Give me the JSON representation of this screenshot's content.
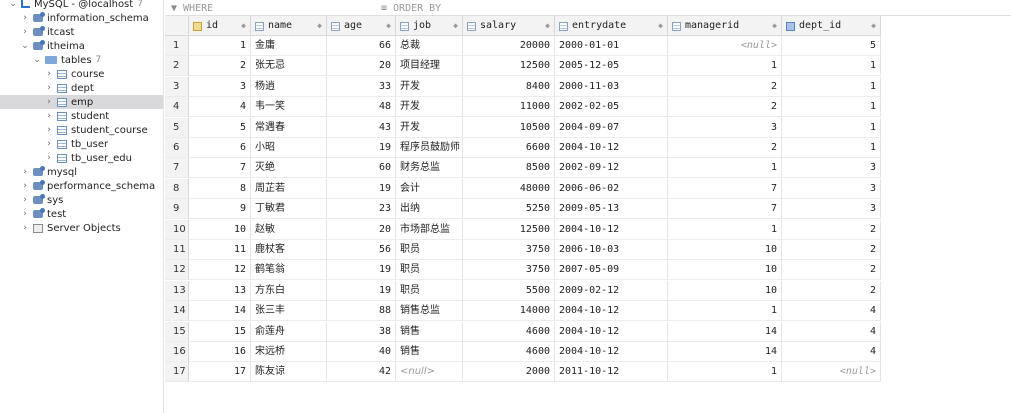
{
  "sidebar": {
    "items": [
      {
        "label": "MySQL - @localhost",
        "badge": "7",
        "icon": "host-icon",
        "chevron": "⌄",
        "depth": 0,
        "name": "tree-item-localhost"
      },
      {
        "label": "information_schema",
        "icon": "database-icon",
        "chevron": "›",
        "depth": 1,
        "name": "tree-item-information-schema"
      },
      {
        "label": "itcast",
        "icon": "database-icon",
        "chevron": "›",
        "depth": 1,
        "name": "tree-item-itcast"
      },
      {
        "label": "itheima",
        "icon": "database-icon",
        "chevron": "⌄",
        "depth": 1,
        "name": "tree-item-itheima"
      },
      {
        "label": "tables",
        "badge": "7",
        "icon": "folder-icon",
        "chevron": "⌄",
        "depth": 2,
        "name": "tree-item-tables"
      },
      {
        "label": "course",
        "icon": "table-icon",
        "chevron": "›",
        "depth": 3,
        "name": "tree-item-course"
      },
      {
        "label": "dept",
        "icon": "table-icon",
        "chevron": "›",
        "depth": 3,
        "name": "tree-item-dept"
      },
      {
        "label": "emp",
        "icon": "table-icon",
        "chevron": "›",
        "depth": 3,
        "name": "tree-item-emp",
        "selected": true
      },
      {
        "label": "student",
        "icon": "table-icon",
        "chevron": "›",
        "depth": 3,
        "name": "tree-item-student"
      },
      {
        "label": "student_course",
        "icon": "table-icon",
        "chevron": "›",
        "depth": 3,
        "name": "tree-item-student-course"
      },
      {
        "label": "tb_user",
        "icon": "table-icon",
        "chevron": "›",
        "depth": 3,
        "name": "tree-item-tb-user"
      },
      {
        "label": "tb_user_edu",
        "icon": "table-icon",
        "chevron": "›",
        "depth": 3,
        "name": "tree-item-tb-user-edu"
      },
      {
        "label": "mysql",
        "icon": "database-icon",
        "chevron": "›",
        "depth": 1,
        "name": "tree-item-mysql"
      },
      {
        "label": "performance_schema",
        "icon": "database-icon",
        "chevron": "›",
        "depth": 1,
        "name": "tree-item-performance-schema"
      },
      {
        "label": "sys",
        "icon": "database-icon",
        "chevron": "›",
        "depth": 1,
        "name": "tree-item-sys"
      },
      {
        "label": "test",
        "icon": "database-icon",
        "chevron": "›",
        "depth": 1,
        "name": "tree-item-test"
      },
      {
        "label": "Server Objects",
        "icon": "server-objects-icon",
        "chevron": "›",
        "depth": 1,
        "name": "tree-item-server-objects"
      }
    ]
  },
  "filter": {
    "where_icon": "filter-icon",
    "where_label": "WHERE",
    "order_icon": "sort-icon",
    "order_label": "ORDER BY"
  },
  "grid": {
    "columns": [
      {
        "key": "id",
        "label": "id",
        "icon": "primary-key-icon",
        "sort_icon": "sort-arrows-icon"
      },
      {
        "key": "name",
        "label": "name",
        "icon": "column-icon",
        "sort_icon": "sort-arrows-icon"
      },
      {
        "key": "age",
        "label": "age",
        "icon": "column-icon",
        "sort_icon": "sort-arrows-icon"
      },
      {
        "key": "job",
        "label": "job",
        "icon": "column-icon",
        "sort_icon": "sort-arrows-icon"
      },
      {
        "key": "salary",
        "label": "salary",
        "icon": "column-icon",
        "sort_icon": "sort-arrows-icon"
      },
      {
        "key": "entrydate",
        "label": "entrydate",
        "icon": "column-icon",
        "sort_icon": "sort-arrows-icon"
      },
      {
        "key": "managerid",
        "label": "managerid",
        "icon": "column-icon",
        "sort_icon": "sort-arrows-icon"
      },
      {
        "key": "dept_id",
        "label": "dept_id",
        "icon": "foreign-key-icon",
        "sort_icon": "sort-arrows-icon"
      }
    ],
    "rows": [
      {
        "n": "1",
        "id": "1",
        "name": "金庸",
        "age": "66",
        "job": "总裁",
        "salary": "20000",
        "entrydate": "2000-01-01",
        "managerid": "<null>",
        "dept_id": "5"
      },
      {
        "n": "2",
        "id": "2",
        "name": "张无忌",
        "age": "20",
        "job": "项目经理",
        "salary": "12500",
        "entrydate": "2005-12-05",
        "managerid": "1",
        "dept_id": "1"
      },
      {
        "n": "3",
        "id": "3",
        "name": "杨逍",
        "age": "33",
        "job": "开发",
        "salary": "8400",
        "entrydate": "2000-11-03",
        "managerid": "2",
        "dept_id": "1"
      },
      {
        "n": "4",
        "id": "4",
        "name": "韦一笑",
        "age": "48",
        "job": "开发",
        "salary": "11000",
        "entrydate": "2002-02-05",
        "managerid": "2",
        "dept_id": "1"
      },
      {
        "n": "5",
        "id": "5",
        "name": "常遇春",
        "age": "43",
        "job": "开发",
        "salary": "10500",
        "entrydate": "2004-09-07",
        "managerid": "3",
        "dept_id": "1"
      },
      {
        "n": "6",
        "id": "6",
        "name": "小昭",
        "age": "19",
        "job": "程序员鼓励师",
        "salary": "6600",
        "entrydate": "2004-10-12",
        "managerid": "2",
        "dept_id": "1"
      },
      {
        "n": "7",
        "id": "7",
        "name": "灭绝",
        "age": "60",
        "job": "财务总监",
        "salary": "8500",
        "entrydate": "2002-09-12",
        "managerid": "1",
        "dept_id": "3"
      },
      {
        "n": "8",
        "id": "8",
        "name": "周芷若",
        "age": "19",
        "job": "会计",
        "salary": "48000",
        "entrydate": "2006-06-02",
        "managerid": "7",
        "dept_id": "3"
      },
      {
        "n": "9",
        "id": "9",
        "name": "丁敏君",
        "age": "23",
        "job": "出纳",
        "salary": "5250",
        "entrydate": "2009-05-13",
        "managerid": "7",
        "dept_id": "3"
      },
      {
        "n": "10",
        "id": "10",
        "name": "赵敏",
        "age": "20",
        "job": "市场部总监",
        "salary": "12500",
        "entrydate": "2004-10-12",
        "managerid": "1",
        "dept_id": "2"
      },
      {
        "n": "11",
        "id": "11",
        "name": "鹿杖客",
        "age": "56",
        "job": "职员",
        "salary": "3750",
        "entrydate": "2006-10-03",
        "managerid": "10",
        "dept_id": "2"
      },
      {
        "n": "12",
        "id": "12",
        "name": "鹤笔翁",
        "age": "19",
        "job": "职员",
        "salary": "3750",
        "entrydate": "2007-05-09",
        "managerid": "10",
        "dept_id": "2"
      },
      {
        "n": "13",
        "id": "13",
        "name": "方东白",
        "age": "19",
        "job": "职员",
        "salary": "5500",
        "entrydate": "2009-02-12",
        "managerid": "10",
        "dept_id": "2"
      },
      {
        "n": "14",
        "id": "14",
        "name": "张三丰",
        "age": "88",
        "job": "销售总监",
        "salary": "14000",
        "entrydate": "2004-10-12",
        "managerid": "1",
        "dept_id": "4"
      },
      {
        "n": "15",
        "id": "15",
        "name": "俞莲舟",
        "age": "38",
        "job": "销售",
        "salary": "4600",
        "entrydate": "2004-10-12",
        "managerid": "14",
        "dept_id": "4"
      },
      {
        "n": "16",
        "id": "16",
        "name": "宋远桥",
        "age": "40",
        "job": "销售",
        "salary": "4600",
        "entrydate": "2004-10-12",
        "managerid": "14",
        "dept_id": "4"
      },
      {
        "n": "17",
        "id": "17",
        "name": "陈友谅",
        "age": "42",
        "job": "<null>",
        "salary": "2000",
        "entrydate": "2011-10-12",
        "managerid": "1",
        "dept_id": "<null>"
      }
    ]
  }
}
